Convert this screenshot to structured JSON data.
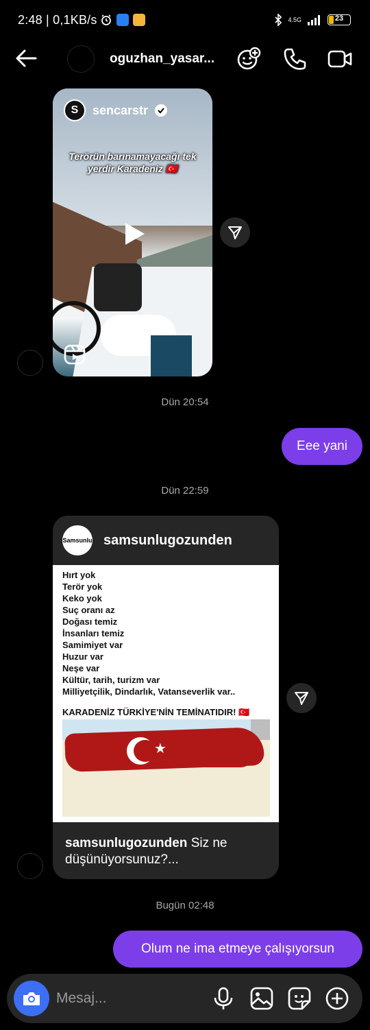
{
  "status": {
    "time": "2:48",
    "speed": "0,1KB/s",
    "network": "4.5G",
    "battery": "23"
  },
  "header": {
    "username": "oguzhan_yasar..."
  },
  "reel": {
    "username": "sencarstr",
    "caption": "Terörün barınamayacağı tek yerdir Karadeniz 🇹🇷"
  },
  "messages": {
    "ts1": "Dün 20:54",
    "out1": "Eee yani",
    "ts2": "Dün 22:59",
    "ts3": "Bugün 02:48",
    "out2": "Olum ne ima etmeye çalışıyorsun"
  },
  "post": {
    "logo_text": "Samsunlu",
    "username": "samsunlugozunden",
    "lines": [
      "Hırt yok",
      "Terör yok",
      "Keko yok",
      "Suç oranı az",
      "Doğası temiz",
      "İnsanları temiz",
      "Samimiyet var",
      "Huzur var",
      "Neşe var",
      "Kültür, tarih, turizm var",
      "Milliyetçilik, Dindarlık, Vatanseverlik var.."
    ],
    "headline": "KARADENİZ TÜRKİYE'NİN TEMİNATIDIR! 🇹🇷",
    "footer_user": "samsunlugozunden",
    "footer_text": "Siz ne düşünüyorsunuz?..."
  },
  "composer": {
    "placeholder": "Mesaj..."
  },
  "colors": {
    "accent": "#7c3ee8",
    "camera": "#3c6ef6",
    "bubble_in": "#262626"
  }
}
